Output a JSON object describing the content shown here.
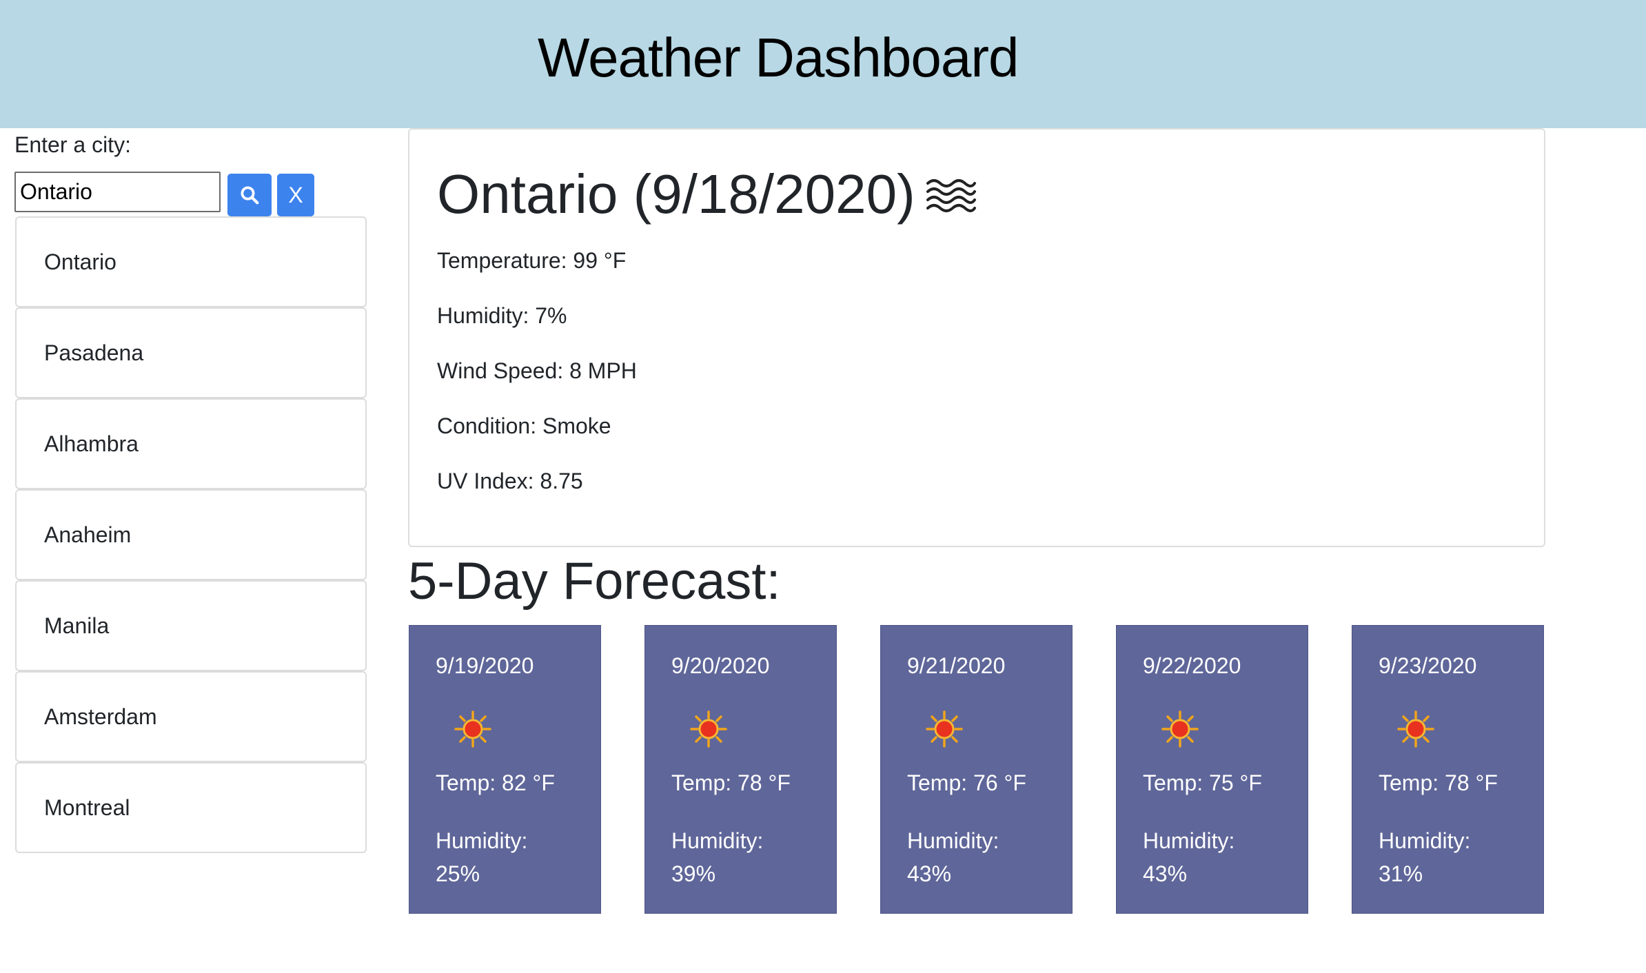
{
  "header": {
    "title": "Weather Dashboard"
  },
  "search": {
    "label": "Enter a city:",
    "value": "Ontario",
    "clear_label": "X"
  },
  "history": [
    "Ontario",
    "Pasadena",
    "Alhambra",
    "Anaheim",
    "Manila",
    "Amsterdam",
    "Montreal"
  ],
  "current": {
    "title": "Ontario (9/18/2020)",
    "icon": "smoke-haze-icon",
    "temperature": "Temperature: 99 °F",
    "humidity": "Humidity: 7%",
    "wind": "Wind Speed: 8 MPH",
    "condition": "Condition: Smoke",
    "uv": "UV Index: 8.75"
  },
  "forecast_title": "5-Day Forecast:",
  "forecast": [
    {
      "date": "9/19/2020",
      "icon": "sun-icon",
      "temp": "Temp: 82 °F",
      "humidity_label": "Humidity:",
      "humidity": "25%"
    },
    {
      "date": "9/20/2020",
      "icon": "sun-icon",
      "temp": "Temp: 78 °F",
      "humidity_label": "Humidity:",
      "humidity": "39%"
    },
    {
      "date": "9/21/2020",
      "icon": "sun-icon",
      "temp": "Temp: 76 °F",
      "humidity_label": "Humidity:",
      "humidity": "43%"
    },
    {
      "date": "9/22/2020",
      "icon": "sun-icon",
      "temp": "Temp: 75 °F",
      "humidity_label": "Humidity:",
      "humidity": "43%"
    },
    {
      "date": "9/23/2020",
      "icon": "sun-icon",
      "temp": "Temp: 78 °F",
      "humidity_label": "Humidity:",
      "humidity": "31%"
    }
  ],
  "colors": {
    "header_bg": "#b7d8e4",
    "button_blue": "#3d83ee",
    "forecast_card_bg": "#5f6699"
  }
}
